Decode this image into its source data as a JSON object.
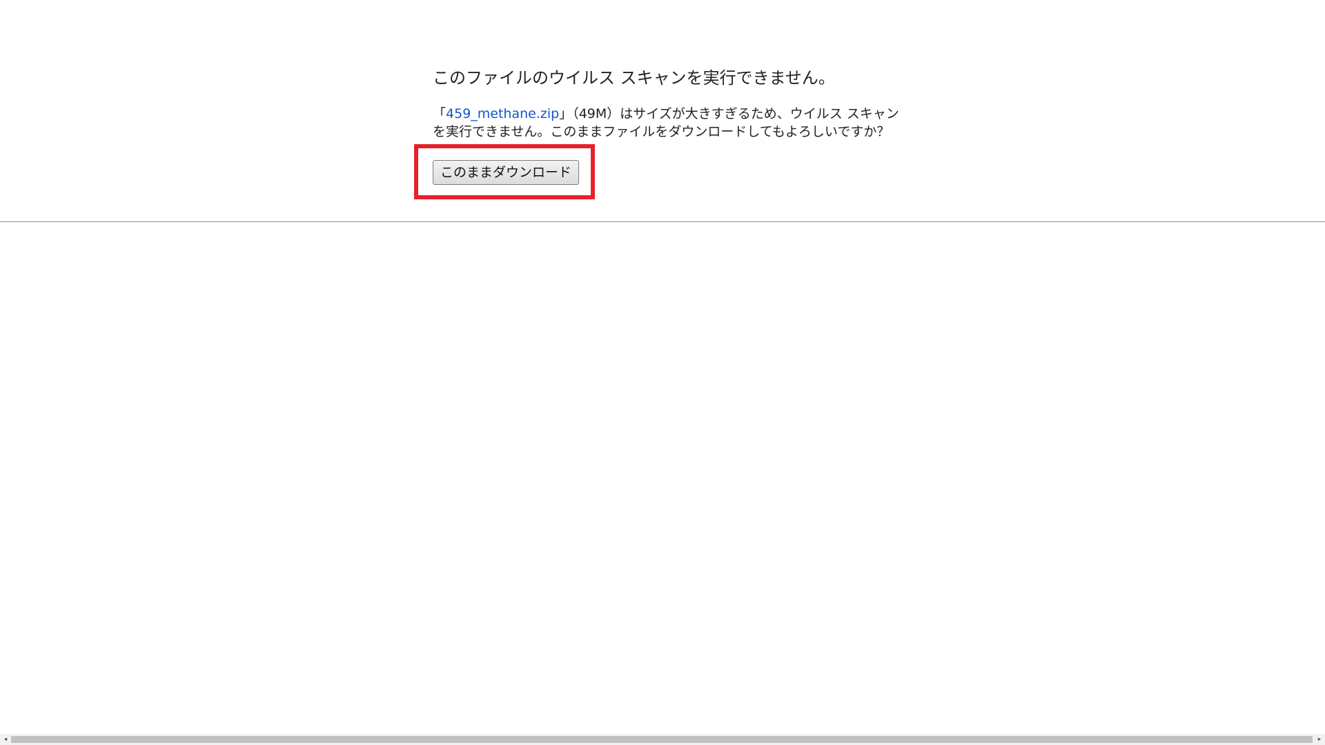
{
  "dialog": {
    "title": "このファイルのウイルス スキャンを実行できません。",
    "message_prefix": "「",
    "file_name": "459_methane.zip",
    "message_suffix": "」（49M）はサイズが大きすぎるため、ウイルス スキャンを実行できません。このままファイルをダウンロードしてもよろしいですか？",
    "download_button_label": "このままダウンロード"
  },
  "colors": {
    "link": "#1155cc",
    "highlight_border": "#e8202a",
    "text": "#222222"
  },
  "icons": {
    "scroll_left": "scroll-left-arrow-icon",
    "scroll_right": "scroll-right-arrow-icon"
  }
}
